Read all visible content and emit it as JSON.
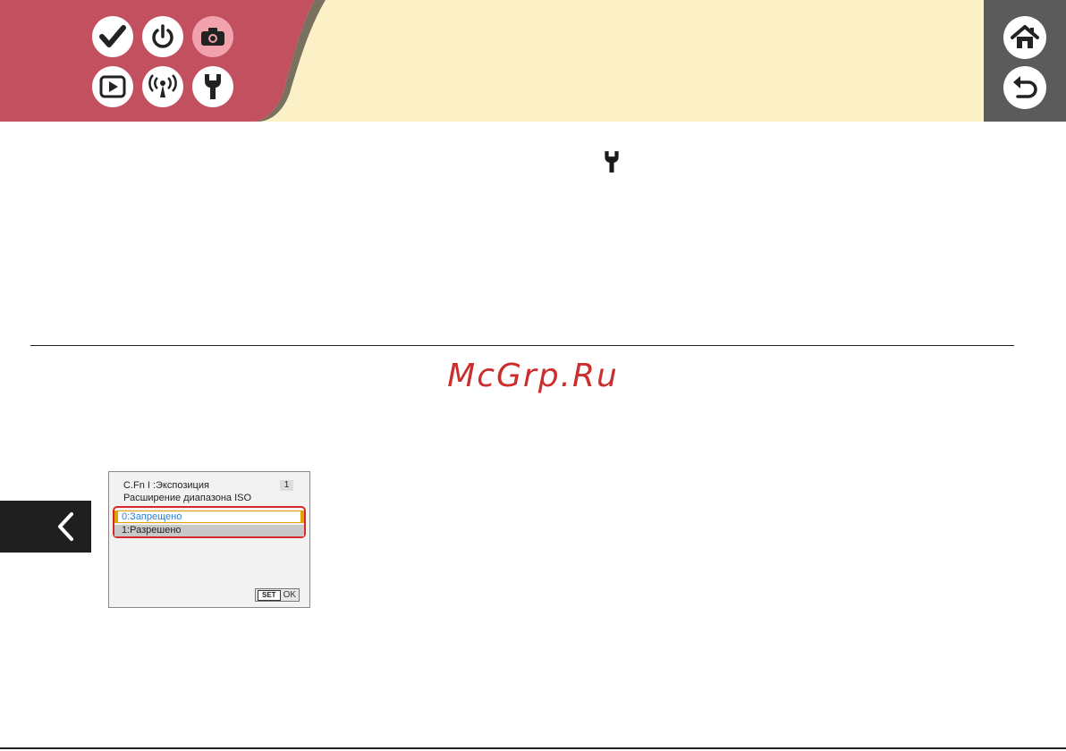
{
  "header": {
    "colors": {
      "band": "#c2505f",
      "olive": "#7a7060",
      "cream": "#fcf0c6",
      "right_bar": "#5b5b5b",
      "active_tab": "#f2a2ac"
    },
    "nav_tabs": [
      {
        "name": "checkmark-icon"
      },
      {
        "name": "power-icon"
      },
      {
        "name": "camera-icon",
        "active": true
      },
      {
        "name": "playback-icon"
      },
      {
        "name": "wireless-icon"
      },
      {
        "name": "wrench-icon"
      }
    ],
    "side_buttons": [
      {
        "name": "home-icon"
      },
      {
        "name": "return-icon"
      }
    ]
  },
  "content": {
    "inline_icon": "wrench-icon",
    "watermark": "McGrp.Ru",
    "watermark_color": "#cc2e2e"
  },
  "camera_screen": {
    "title": "C.Fn I :Экспозиция",
    "page": "1",
    "subtitle": "Расширение диапазона ISO",
    "options": [
      "0:Запрещено",
      "1:Разрешено"
    ],
    "selected_index": 0,
    "set_label": "SET",
    "ok_label": "OK"
  },
  "back_tab_icon": "chevron-left-icon"
}
